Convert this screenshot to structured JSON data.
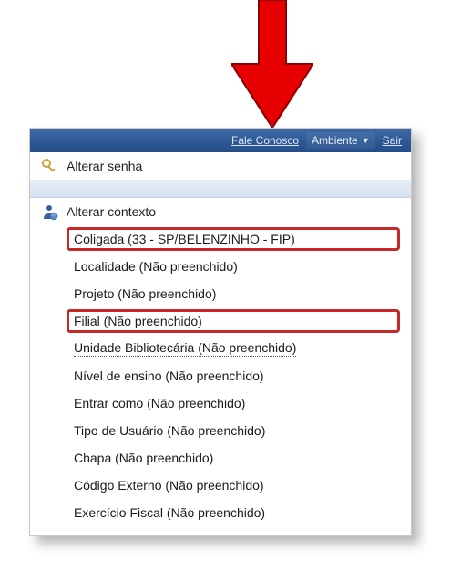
{
  "topbar": {
    "contact_label": "Fale Conosco",
    "environment_label": "Ambiente",
    "logout_label": "Sair"
  },
  "menu": {
    "change_password_label": "Alterar senha",
    "change_context_label": "Alterar contexto"
  },
  "context_items": [
    {
      "label": "Coligada (33 - SP/BELENZINHO - FIP)",
      "highlighted": true,
      "dashed": false
    },
    {
      "label": "Localidade (Não preenchido)",
      "highlighted": false,
      "dashed": false
    },
    {
      "label": "Projeto (Não preenchido)",
      "highlighted": false,
      "dashed": false
    },
    {
      "label": "Filial (Não preenchido)",
      "highlighted": true,
      "dashed": false
    },
    {
      "label": "Unidade Bibliotecária (Não preenchido)",
      "highlighted": false,
      "dashed": true
    },
    {
      "label": "Nível de ensino (Não preenchido)",
      "highlighted": false,
      "dashed": false
    },
    {
      "label": "Entrar como (Não preenchido)",
      "highlighted": false,
      "dashed": false
    },
    {
      "label": "Tipo de Usuário (Não preenchido)",
      "highlighted": false,
      "dashed": false
    },
    {
      "label": "Chapa (Não preenchido)",
      "highlighted": false,
      "dashed": false
    },
    {
      "label": "Código Externo (Não preenchido)",
      "highlighted": false,
      "dashed": false
    },
    {
      "label": "Exercício Fiscal (Não preenchido)",
      "highlighted": false,
      "dashed": false
    }
  ]
}
